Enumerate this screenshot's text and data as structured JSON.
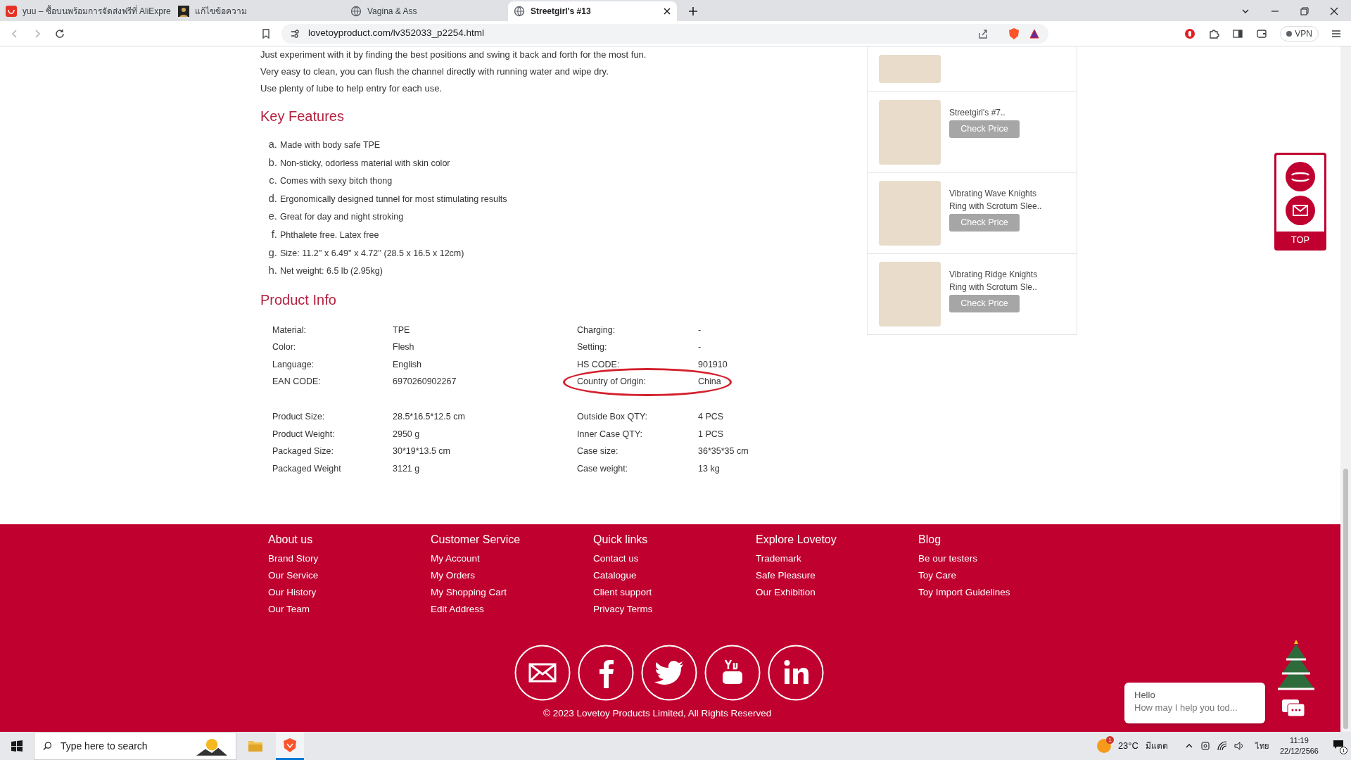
{
  "browser": {
    "tabs": [
      {
        "title": "yuu – ซื้อบนพร้อมการจัดส่งฟรีที่ AliExpre",
        "kind": "shop",
        "selected": false
      },
      {
        "title": "แก้ไขข้อความ",
        "kind": "avatar",
        "selected": false
      },
      {
        "title": "Vagina & Ass",
        "kind": "globe",
        "selected": false
      },
      {
        "title": "Streetgirl's #13",
        "kind": "globe",
        "selected": true
      }
    ],
    "url": "lovetoyproduct.com/lv352033_p2254.html",
    "vpn": "VPN"
  },
  "description": [
    "Just experiment with it by finding the best positions and swing it back and forth for the most fun.",
    "Very easy to clean, you can flush the channel directly with running water and wipe dry.",
    "Use plenty of lube to help entry for each use."
  ],
  "key_features": {
    "heading": "Key Features",
    "items": [
      {
        "marker": "a.",
        "text": "Made with body safe TPE"
      },
      {
        "marker": "b.",
        "text": "Non-sticky, odorless material with skin color"
      },
      {
        "marker": "c.",
        "text": "Comes with sexy bitch thong"
      },
      {
        "marker": "d.",
        "text": "Ergonomically designed tunnel for most stimulating results"
      },
      {
        "marker": "e.",
        "text": "Great for day and night stroking"
      },
      {
        "marker": "f.",
        "text": "Phthalete free. Latex free"
      },
      {
        "marker": "g.",
        "text": "Size: 11.2'' x 6.49'' x 4.72'' (28.5 x 16.5 x 12cm)"
      },
      {
        "marker": "h.",
        "text": "Net weight: 6.5 lb (2.95kg)"
      }
    ]
  },
  "product_info": {
    "heading": "Product Info",
    "sections": [
      [
        {
          "label": "Material:",
          "value": "TPE",
          "label_2": "Charging:",
          "value_2": "-",
          "circled": false
        },
        {
          "label": "Color:",
          "value": "Flesh",
          "label_2": "Setting:",
          "value_2": "-",
          "circled": false
        },
        {
          "label": "Language:",
          "value": "English",
          "label_2": "HS CODE:",
          "value_2": "901910",
          "circled": false
        },
        {
          "label": "EAN CODE:",
          "value": "6970260902267",
          "label_2": "Country of Origin:",
          "value_2": "China",
          "circled": true
        }
      ],
      [
        {
          "label": "Product Size:",
          "value": "28.5*16.5*12.5 cm",
          "label_2": "Outside Box QTY:",
          "value_2": "4 PCS",
          "circled": false
        },
        {
          "label": "Product Weight:",
          "value": "2950 g",
          "label_2": "Inner Case QTY:",
          "value_2": "1 PCS",
          "circled": false
        },
        {
          "label": "Packaged Size:",
          "value": "30*19*13.5 cm",
          "label_2": "Case size:",
          "value_2": "36*35*35 cm",
          "circled": false
        },
        {
          "label": "Packaged Weight",
          "value": "3121 g",
          "label_2": "Case weight:",
          "value_2": "13 kg",
          "circled": false
        }
      ]
    ]
  },
  "related_products": [
    {
      "kind": "cut"
    },
    {
      "kind": "full",
      "name": "Streetgirl's #7..",
      "button": "Check Price"
    },
    {
      "kind": "full",
      "name": "Vibrating Wave Knights Ring with Scrotum Slee..",
      "button": "Check Price"
    },
    {
      "kind": "full",
      "name": "Vibrating Ridge Knights Ring with Scrotum Sle..",
      "button": "Check Price"
    }
  ],
  "side_widget": {
    "top": "TOP"
  },
  "footer": {
    "columns": [
      {
        "heading": "About us",
        "links": [
          "Brand Story",
          "Our Service",
          "Our History",
          "Our Team"
        ]
      },
      {
        "heading": "Customer Service",
        "links": [
          "My Account",
          "My Orders",
          "My Shopping Cart",
          "Edit Address"
        ]
      },
      {
        "heading": "Quick links",
        "links": [
          "Contact us",
          "Catalogue",
          "Client support",
          "Privacy Terms"
        ]
      },
      {
        "heading": "Explore Lovetoy",
        "links": [
          "Trademark",
          "Safe Pleasure",
          "Our Exhibition"
        ]
      },
      {
        "heading": "Blog",
        "links": [
          "Be our testers",
          "Toy Care",
          "Toy Import Guidelines"
        ]
      }
    ],
    "copyright": "© 2023 Lovetoy Products Limited, All Rights Reserved"
  },
  "chat": {
    "greeting": "Hello",
    "message": "How may I help you tod..."
  },
  "taskbar": {
    "search_placeholder": "Type here to search",
    "weather_badge": "1",
    "temperature": "23°C",
    "weather": "มีแดด",
    "language": "ไทย",
    "time": "11:19",
    "date": "22/12/2566",
    "notifications": "1"
  }
}
